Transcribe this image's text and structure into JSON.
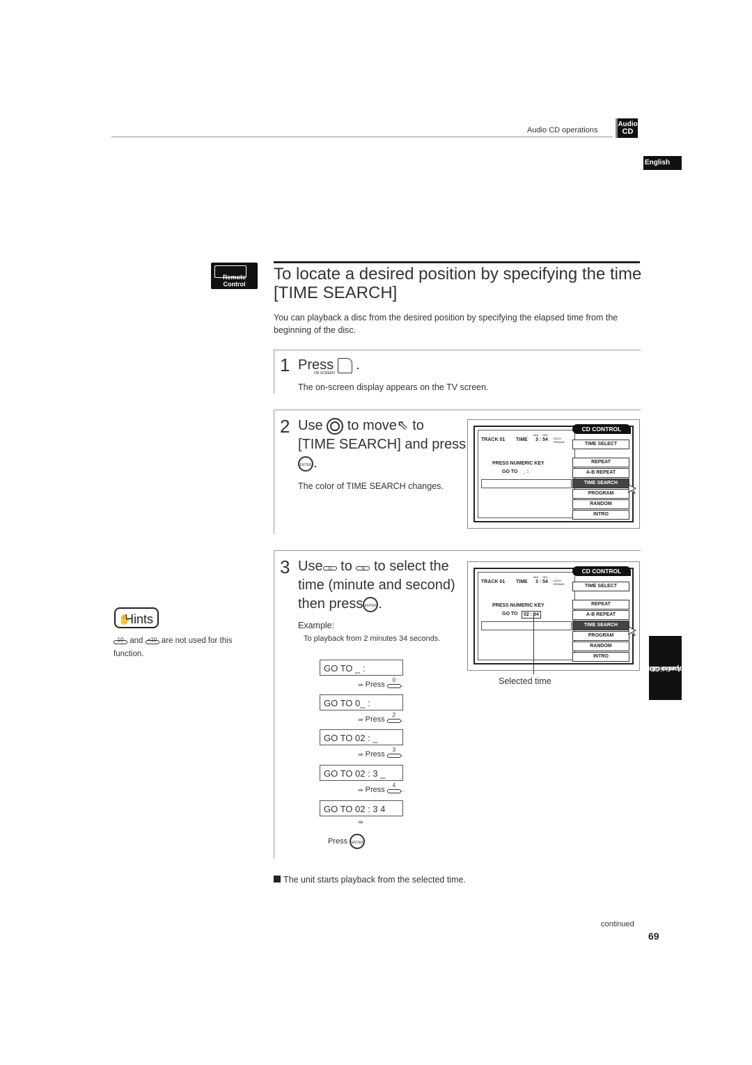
{
  "header": {
    "section_label": "Audio CD operations",
    "badge_line1": "Audio",
    "badge_line2": "CD",
    "language": "English"
  },
  "title": {
    "remote_label": "Remote Control",
    "line1": "To locate a desired position by specifying the time",
    "line2": "[TIME SEARCH]",
    "intro": "You can playback a disc from the desired position by specifying the elapsed time from the beginning of the disc."
  },
  "step1": {
    "number": "1",
    "text": "Press",
    "button_label": "ON SCREEN",
    "note": "The on-screen display appears on the TV screen."
  },
  "step2": {
    "number": "2",
    "use": "Use",
    "to_move": "to move",
    "to": "to",
    "line2": "[TIME SEARCH] and press",
    "enter_label": "ENTER",
    "note": "The color of   TIME SEARCH changes."
  },
  "step3": {
    "number": "3",
    "use": "Use",
    "key_from": "0",
    "to": "to",
    "key_to": "9",
    "tail": "to select the",
    "line2": "time (minute and second)",
    "line3": "then press",
    "enter_label": "ENTER",
    "example_label": "Example:",
    "example_text": "To playback from 2 minutes 34 seconds.",
    "sequence": [
      {
        "display": "GO TO _    :",
        "press": "Press",
        "key": "0"
      },
      {
        "display": "GO TO 0_  :",
        "press": "Press",
        "key": "2"
      },
      {
        "display": "GO TO 02  :  _",
        "press": "Press",
        "key": "3"
      },
      {
        "display": "GO TO 02  :  3 _",
        "press": "Press",
        "key": "4"
      },
      {
        "display": "GO TO 02  :  3 4",
        "press": "",
        "key": ""
      }
    ],
    "final_press": "Press",
    "selected_time_label": "Selected time",
    "result": "The unit starts playback from the selected time."
  },
  "osd": {
    "track": "TRACK 01",
    "time_label": "TIME",
    "time_value": "3 : 54",
    "min": "MIN",
    "sec": "SEC",
    "each": "EACH",
    "remain": "REMAIN",
    "press_key": "PRESS NUMERIC KEY",
    "goto_label": "GO TO",
    "goto_empty": "_  :",
    "goto_filled": "02 : 34",
    "cd_control": "CD CONTROL",
    "menu": [
      "TIME SELECT",
      "REPEAT",
      "A-B REPEAT",
      "TIME SEARCH",
      "PROGRAM",
      "RANDOM",
      "INTRO"
    ],
    "selected": "TIME SEARCH"
  },
  "hints": {
    "title": "Hints",
    "key1": "10",
    "and": "and",
    "key2": "+10",
    "text": "are not used for this function."
  },
  "side_tab": {
    "line1": "Audio CD",
    "line2": "operations"
  },
  "footer": {
    "continued": "continued",
    "page": "69"
  }
}
